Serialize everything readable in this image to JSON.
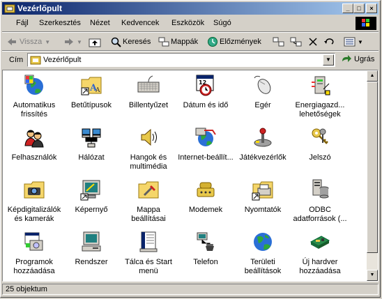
{
  "window": {
    "title": "Vezérlőpult"
  },
  "menu": [
    "Fájl",
    "Szerkesztés",
    "Nézet",
    "Kedvencek",
    "Eszközök",
    "Súgó"
  ],
  "toolbar": {
    "back": "Vissza",
    "search": "Keresés",
    "folders": "Mappák",
    "history": "Előzmények"
  },
  "address": {
    "label": "Cím",
    "value": "Vezérlőpult",
    "go": "Ugrás"
  },
  "items": [
    {
      "label": "Automatikus frissítés",
      "icon": "automatic-update-icon"
    },
    {
      "label": "Betűtípusok",
      "icon": "fonts-icon"
    },
    {
      "label": "Billentyűzet",
      "icon": "keyboard-icon"
    },
    {
      "label": "Dátum és idő",
      "icon": "calendar-clock-icon"
    },
    {
      "label": "Egér",
      "icon": "mouse-icon"
    },
    {
      "label": "Energiagazd... lehetőségek",
      "icon": "power-icon"
    },
    {
      "label": "Felhasználók",
      "icon": "users-icon"
    },
    {
      "label": "Hálózat",
      "icon": "network-icon"
    },
    {
      "label": "Hangok és multimédia",
      "icon": "speaker-icon"
    },
    {
      "label": "Internet-beállít...",
      "icon": "internet-icon"
    },
    {
      "label": "Játékvezérlők",
      "icon": "joystick-icon"
    },
    {
      "label": "Jelszó",
      "icon": "keys-icon"
    },
    {
      "label": "Képdigitalizálók és kamerák",
      "icon": "camera-folder-icon"
    },
    {
      "label": "Képernyő",
      "icon": "display-icon"
    },
    {
      "label": "Mappa beállításai",
      "icon": "folder-options-icon"
    },
    {
      "label": "Modemek",
      "icon": "modem-icon"
    },
    {
      "label": "Nyomtatók",
      "icon": "printer-icon"
    },
    {
      "label": "ODBC adatforrások (...",
      "icon": "odbc-icon"
    },
    {
      "label": "Programok hozzáadása",
      "icon": "add-programs-icon"
    },
    {
      "label": "Rendszer",
      "icon": "computer-icon"
    },
    {
      "label": "Tálca és Start menü",
      "icon": "taskbar-icon"
    },
    {
      "label": "Telefon",
      "icon": "telephony-icon"
    },
    {
      "label": "Területi beállítások",
      "icon": "globe-icon"
    },
    {
      "label": "Új hardver hozzáadása",
      "icon": "add-hardware-icon"
    }
  ],
  "status": {
    "text": "25 objektum"
  }
}
